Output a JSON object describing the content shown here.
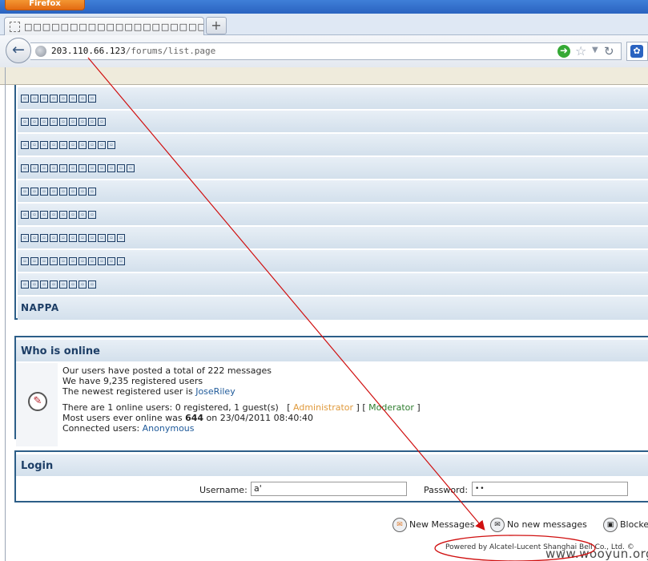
{
  "browser": {
    "app_button": "Firefox",
    "tab_title": "□□□□□□□□□□□□□□□□□□□□□□...",
    "new_tab": "+",
    "url_host": "203.110.66.123",
    "url_path": "/forums/list.page"
  },
  "forum": {
    "categories": [
      {
        "glyphs": 8
      },
      {
        "glyphs": 9
      },
      {
        "glyphs": 10
      },
      {
        "glyphs": 12
      },
      {
        "glyphs": 8
      },
      {
        "glyphs": 8
      },
      {
        "glyphs": 11
      },
      {
        "glyphs": 11
      },
      {
        "glyphs": 8
      }
    ],
    "nappa_label": "NAPPA"
  },
  "online": {
    "title": "Who is online",
    "line1": "Our users have posted a total of 222 messages",
    "line2": "We have 9,235 registered users",
    "line3_prefix": "The newest registered user is ",
    "line3_user": "JoseRiley",
    "line4_prefix": "There are 1 online users: 0 registered, 1 guest(s)   [ ",
    "line4_admin": "Administrator",
    "line4_mid": " ] [ ",
    "line4_mod": "Moderator",
    "line4_end": " ]",
    "line5_prefix": "Most users ever online was ",
    "line5_count": "644",
    "line5_suffix": " on 23/04/2011 08:40:40",
    "line6_prefix": "Connected users: ",
    "line6_user": "Anonymous"
  },
  "login": {
    "title": "Login",
    "username_label": "Username:",
    "username_value": "a'",
    "password_label": "Password:",
    "password_value": "••"
  },
  "legend": {
    "new_messages": "New Messages",
    "no_new_messages": "No new messages",
    "blocked": "Blocke"
  },
  "footer": {
    "powered_by": "Powered by Alcatel-Lucent Shanghai Bell Co., Ltd. ©",
    "watermark": "www.wooyun.org"
  },
  "annotation": {
    "color": "#d01010"
  }
}
